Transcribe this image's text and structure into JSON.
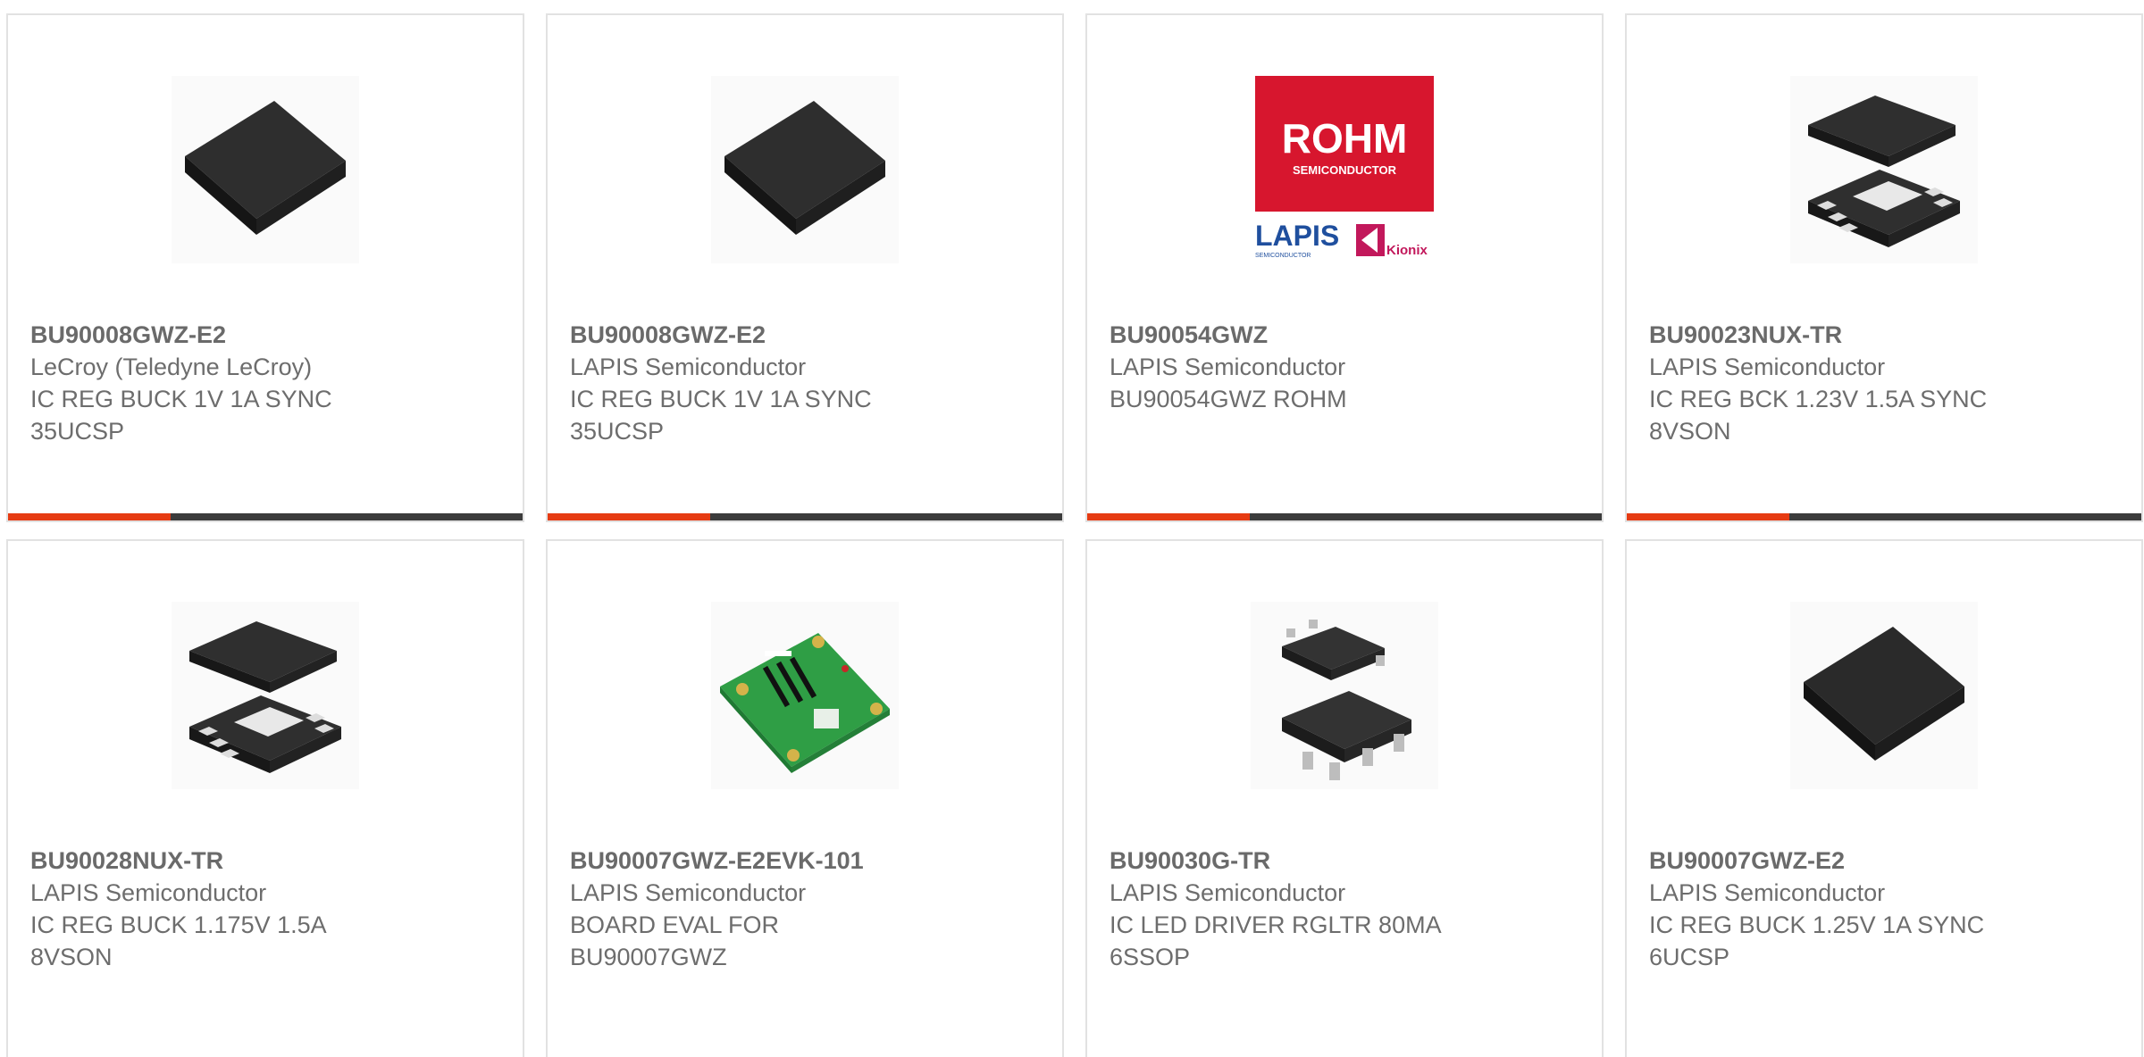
{
  "products": [
    {
      "part_number": "BU90008GWZ-E2",
      "manufacturer": "LeCroy (Teledyne LeCroy)",
      "desc_line1": "IC REG BUCK 1V 1A SYNC",
      "desc_line2": "35UCSP",
      "image": "black-chip-package-icon"
    },
    {
      "part_number": "BU90008GWZ-E2",
      "manufacturer": "LAPIS Semiconductor",
      "desc_line1": "IC REG BUCK 1V 1A SYNC",
      "desc_line2": "35UCSP",
      "image": "black-chip-package-icon"
    },
    {
      "part_number": "BU90054GWZ",
      "manufacturer": "LAPIS Semiconductor",
      "desc_line1": "BU90054GWZ ROHM",
      "desc_line2": "",
      "image": "rohm-logo",
      "logo": {
        "rohm": "ROHM",
        "rohm_sub": "SEMICONDUCTOR",
        "lapis": "LAPIS",
        "lapis_sub": "SEMICONDUCTOR",
        "kionix": "Kionix",
        "colors": {
          "rohm_red": "#d7162e",
          "lapis_blue": "#1f4f9e",
          "kionix_magenta": "#c2185b"
        }
      }
    },
    {
      "part_number": "BU90023NUX-TR",
      "manufacturer": "LAPIS Semiconductor",
      "desc_line1": "IC REG BCK 1.23V 1.5A SYNC",
      "desc_line2": "8VSON",
      "image": "son-package-icon"
    },
    {
      "part_number": "BU90028NUX-TR",
      "manufacturer": "LAPIS Semiconductor",
      "desc_line1": "IC REG BUCK 1.175V 1.5A",
      "desc_line2": "8VSON",
      "image": "son-package-icon"
    },
    {
      "part_number": "BU90007GWZ-E2EVK-101",
      "manufacturer": "LAPIS Semiconductor",
      "desc_line1": "BOARD EVAL FOR",
      "desc_line2": "BU90007GWZ",
      "image": "eval-board-icon"
    },
    {
      "part_number": "BU90030G-TR",
      "manufacturer": "LAPIS Semiconductor",
      "desc_line1": "IC LED DRIVER RGLTR 80MA",
      "desc_line2": "6SSOP",
      "image": "ssop-package-icon"
    },
    {
      "part_number": "BU90007GWZ-E2",
      "manufacturer": "LAPIS Semiconductor",
      "desc_line1": "IC REG BUCK 1.25V 1A SYNC",
      "desc_line2": "6UCSP",
      "image": "black-chip-package-icon"
    }
  ],
  "colors": {
    "accent": "#e63b12",
    "bar_dark": "#3c3c3c",
    "text": "#6d6d6d",
    "border": "#e2e2e2"
  }
}
